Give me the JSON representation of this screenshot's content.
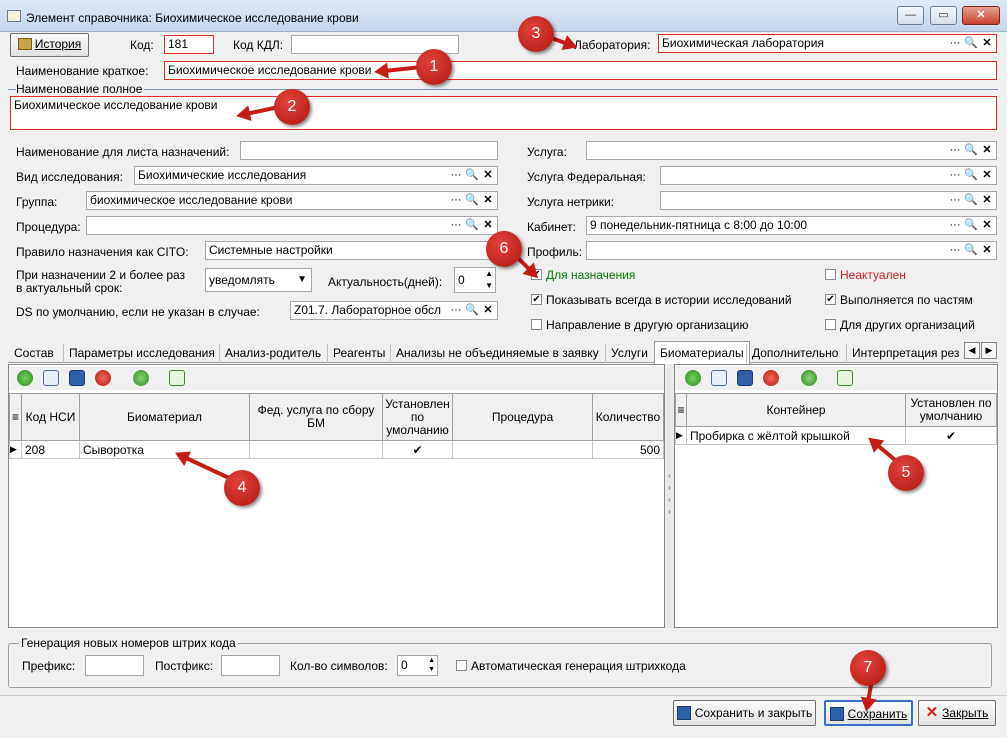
{
  "window": {
    "title": "Элемент справочника: Биохимическое исследование крови"
  },
  "header": {
    "history_btn": "История",
    "code_label": "Код:",
    "code_value": "181",
    "kdl_label": "Код КДЛ:",
    "kdl_value": "",
    "lab_label": "Лаборатория:",
    "lab_value": "Биохимическая лаборатория"
  },
  "names": {
    "short_label": "Наименование краткое:",
    "short_value": "Биохимическое исследование крови",
    "full_label": "Наименование полное",
    "full_value": "Биохимическое исследование крови"
  },
  "left": {
    "list_name_label": "Наименование для листа назначений:",
    "list_name_value": "",
    "kind_label": "Вид исследования:",
    "kind_value": "Биохимические исследования",
    "group_label": "Группа:",
    "group_value": "биохимическое исследование крови",
    "proc_label": "Процедура:",
    "proc_value": "",
    "cito_label": "Правило назначения как CITO:",
    "cito_value": "Системные настройки",
    "repeat_label_1": "При назначении 2 и более раз",
    "repeat_label_2": "в актуальный срок:",
    "repeat_value": "уведомлять",
    "actual_label": "Актуальность(дней):",
    "actual_value": "0",
    "ds_label": "DS по умолчанию, если не указан в случае:",
    "ds_value": "Z01.7. Лабораторное обсл"
  },
  "right": {
    "service_label": "Услуга:",
    "service_value": "",
    "fed_label": "Услуга Федеральная:",
    "fed_value": "",
    "nonmetric_label": "Услуга нетрики:",
    "nonmetric_value": "",
    "cabinet_label": "Кабинет:",
    "cabinet_value": "9 понедельник-пятница с 8:00 до 10:00",
    "profile_label": "Профиль:",
    "profile_value": ""
  },
  "checks": {
    "for_assign": "Для назначения",
    "inactive": "Неактуален",
    "show_history": "Показывать всегда в истории исследований",
    "by_parts": "Выполняется по частям",
    "other_org_dir": "Направление в другую организацию",
    "for_other_orgs": "Для других организаций"
  },
  "tabs": [
    "Состав",
    "Параметры исследования",
    "Анализ-родитель",
    "Реагенты",
    "Анализы не объединяемые в заявку",
    "Услуги",
    "Биоматериалы",
    "Дополнительно",
    "Интерпретация рез"
  ],
  "left_grid": {
    "headers": [
      "Код НСИ",
      "Биоматериал",
      "Фед. услуга по сбору БМ",
      "Установлен по умолчанию",
      "Процедура",
      "Количество"
    ],
    "rows": [
      {
        "code": "208",
        "bio": "Сыворотка",
        "fed": "",
        "def": "✔",
        "proc": "",
        "qty": "500"
      }
    ]
  },
  "right_grid": {
    "headers": [
      "Контейнер",
      "Установлен по умолчанию"
    ],
    "rows": [
      {
        "container": "Пробирка с жёлтой крышкой",
        "def": "✔"
      }
    ]
  },
  "barcode": {
    "legend": "Генерация новых номеров штрих кода",
    "prefix_label": "Префикс:",
    "prefix_value": "",
    "postfix_label": "Постфикс:",
    "postfix_value": "",
    "count_label": "Кол-во символов:",
    "count_value": "0",
    "auto_label": "Автоматическая генерация штрихкода"
  },
  "footer": {
    "save_close": "Сохранить и закрыть",
    "save": "Сохранить",
    "close": "Закрыть"
  },
  "annotations": [
    "1",
    "2",
    "3",
    "4",
    "5",
    "6",
    "7"
  ],
  "colors": {
    "annotation": "#c51c16",
    "required_border": "#e0302a",
    "active_check": "#008000",
    "inactive_check": "#d02020"
  }
}
